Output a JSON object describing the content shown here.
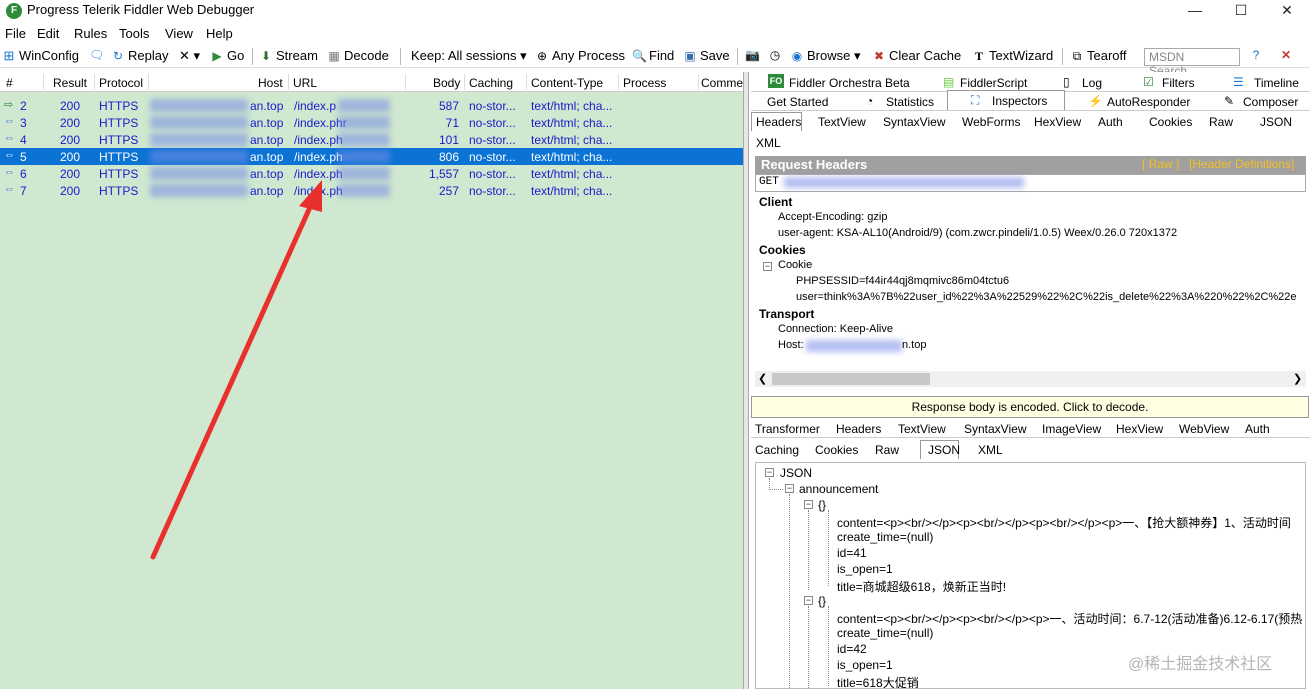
{
  "window": {
    "title": "Progress Telerik Fiddler Web Debugger",
    "controls": {
      "minimize": "—",
      "maximize": "☐",
      "close": "✕"
    }
  },
  "menu": [
    "File",
    "Edit",
    "Rules",
    "Tools",
    "View",
    "Help"
  ],
  "toolbar": {
    "winconfig": "WinConfig",
    "replay": "Replay",
    "remove": "✕ ▾",
    "go": "Go",
    "stream": "Stream",
    "decode": "Decode",
    "keep": "Keep: All sessions ▾",
    "any_process": "Any Process",
    "find": "Find",
    "save": "Save",
    "browse": "Browse ▾",
    "clear_cache": "Clear Cache",
    "textwizard": "TextWizard",
    "tearoff": "Tearoff",
    "msdn_placeholder": "MSDN Search..."
  },
  "sessions": {
    "columns": [
      "#",
      "Result",
      "Protocol",
      "Host",
      "URL",
      "Body",
      "Caching",
      "Content-Type",
      "Process",
      "Commen"
    ],
    "rows": [
      {
        "num": "2",
        "result": "200",
        "protocol": "HTTPS",
        "host": "an.top",
        "url": "/index.p",
        "body": "587",
        "caching": "no-stor...",
        "ctype": "text/html; cha..."
      },
      {
        "num": "3",
        "result": "200",
        "protocol": "HTTPS",
        "host": "an.top",
        "url": "/index.phr",
        "body": "71",
        "caching": "no-stor...",
        "ctype": "text/html; cha..."
      },
      {
        "num": "4",
        "result": "200",
        "protocol": "HTTPS",
        "host": "an.top",
        "url": "/index.ph",
        "body": "101",
        "caching": "no-stor...",
        "ctype": "text/html; cha..."
      },
      {
        "num": "5",
        "result": "200",
        "protocol": "HTTPS",
        "host": "an.top",
        "url": "/index.ph",
        "body": "806",
        "caching": "no-stor...",
        "ctype": "text/html; cha..."
      },
      {
        "num": "6",
        "result": "200",
        "protocol": "HTTPS",
        "host": "an.top",
        "url": "/index.ph",
        "body": "1,557",
        "caching": "no-stor...",
        "ctype": "text/html; cha..."
      },
      {
        "num": "7",
        "result": "200",
        "protocol": "HTTPS",
        "host": "an.top",
        "url": "/index.ph",
        "body": "257",
        "caching": "no-stor...",
        "ctype": "text/html; cha..."
      }
    ],
    "selected_row": "5"
  },
  "top_tabs_row1": [
    "Fiddler Orchestra Beta",
    "FiddlerScript",
    "Log",
    "Filters",
    "Timeline"
  ],
  "top_tabs_row2": [
    "Get Started",
    "Statistics",
    "Inspectors",
    "AutoResponder",
    "Composer"
  ],
  "icon_badges": {
    "fo": "FO"
  },
  "req_tabs_row1": [
    "Headers",
    "TextView",
    "SyntaxView",
    "WebForms",
    "HexView",
    "Auth",
    "Cookies",
    "Raw",
    "JSON"
  ],
  "req_tabs_row2": [
    "XML"
  ],
  "request_headers": {
    "title": "Request Headers",
    "raw": "[ Raw ]",
    "defs": "[Header Definitions]",
    "method": "GET",
    "client_label": "Client",
    "accept_encoding": "Accept-Encoding: gzip",
    "user_agent": "user-agent: KSA-AL10(Android/9) (com.zwcr.pindeli/1.0.5) Weex/0.26.0 720x1372",
    "cookies_label": "Cookies",
    "cookie_label": "Cookie",
    "phpsessid": "PHPSESSID=f44ir44qj8mqmivc86m04tctu6",
    "user_cookie": "user=think%3A%7B%22user_id%22%3A%22529%22%2C%22is_delete%22%3A%220%22%2C%22e",
    "transport_label": "Transport",
    "connection": "Connection: Keep-Alive",
    "host": "Host:",
    "host_tail": "n.top"
  },
  "notice": "Response body is encoded. Click to decode.",
  "resp_tabs_row1": [
    "Transformer",
    "Headers",
    "TextView",
    "SyntaxView",
    "ImageView",
    "HexView",
    "WebView",
    "Auth"
  ],
  "resp_tabs_row2": [
    "Caching",
    "Cookies",
    "Raw",
    "JSON",
    "XML"
  ],
  "json_tree": {
    "root": "JSON",
    "announcement": "announcement",
    "obj": "{}",
    "item1": {
      "content": "content=<p><br/></p><p><br/></p><p><br/></p><p>一、【抢大额神券】1、活动时间",
      "create_time": "create_time=(null)",
      "id": "id=41",
      "is_open": "is_open=1",
      "title": "title=商城超级618，焕新正当时!"
    },
    "item2": {
      "content": "content=<p><br/></p><p><br/></p><p>一、活动时间：6.7-12(活动准备)6.12-6.17(预热",
      "create_time": "create_time=(null)",
      "id": "id=42",
      "is_open": "is_open=1",
      "title": "title=618大促销"
    },
    "expander_open": "−"
  },
  "watermark": "@稀土掘金技术社区",
  "colors": {
    "session_bg": "#cfe8cf",
    "selected": "#0a73d4",
    "row_text": "#1a1acd",
    "arrow": "#e8312f"
  }
}
